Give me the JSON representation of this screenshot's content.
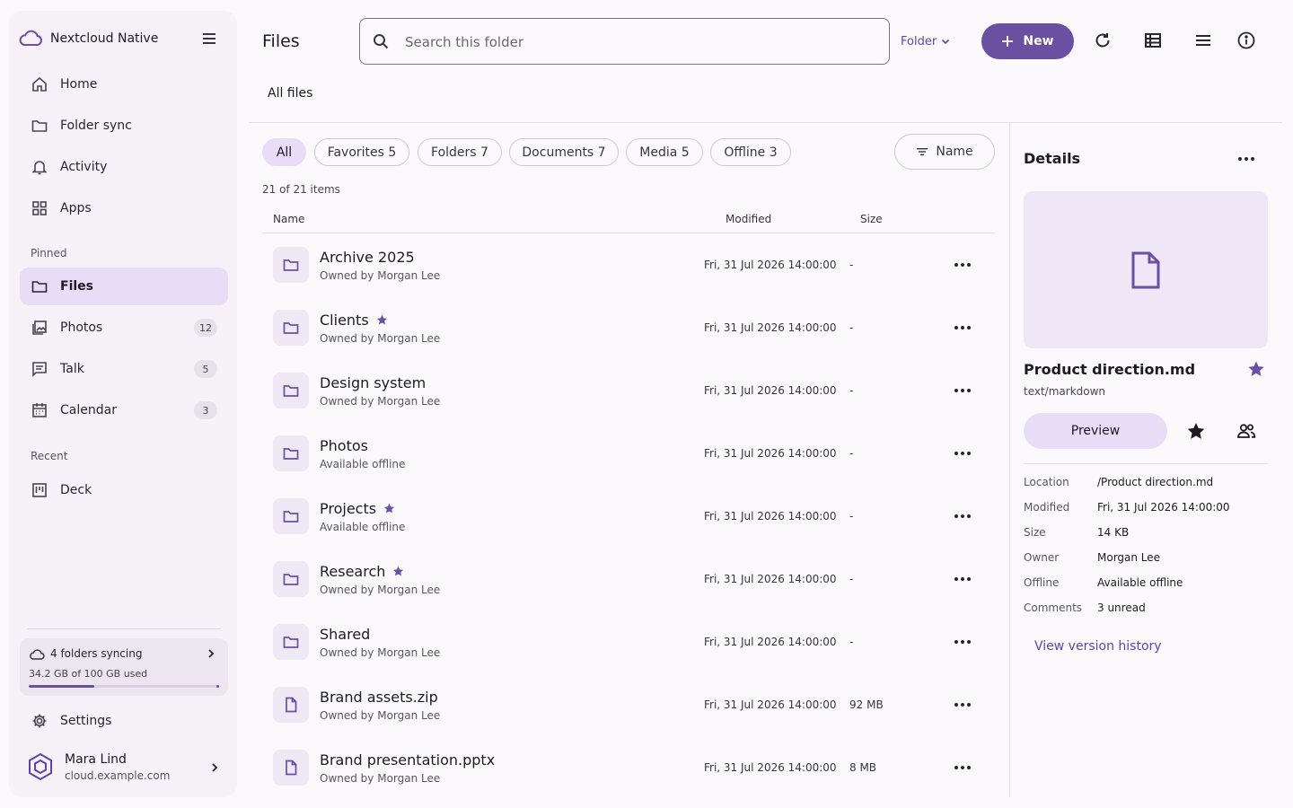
{
  "app": {
    "name": "Nextcloud Native"
  },
  "sidebar": {
    "nav": [
      {
        "label": "Home",
        "icon": "home-icon"
      },
      {
        "label": "Folder sync",
        "icon": "folder-icon"
      },
      {
        "label": "Activity",
        "icon": "bell-icon"
      },
      {
        "label": "Apps",
        "icon": "apps-grid-icon"
      }
    ],
    "pinned_label": "Pinned",
    "pinned": [
      {
        "label": "Files",
        "icon": "folder-icon",
        "active": true
      },
      {
        "label": "Photos",
        "icon": "photos-icon",
        "count": "12"
      },
      {
        "label": "Talk",
        "icon": "chat-icon",
        "count": "5"
      },
      {
        "label": "Calendar",
        "icon": "calendar-icon",
        "count": "3"
      }
    ],
    "recent_label": "Recent",
    "recent": [
      {
        "label": "Deck",
        "icon": "deck-icon"
      }
    ],
    "sync": {
      "status": "4 folders syncing",
      "usage": "34.2 GB of 100 GB used",
      "used_fraction": 0.342
    },
    "settings_label": "Settings",
    "user": {
      "name": "Mara Lind",
      "server": "cloud.example.com"
    }
  },
  "header": {
    "title": "Files",
    "search_placeholder": "Search this folder",
    "scope_label": "Folder",
    "new_label": "New"
  },
  "breadcrumb": "All files",
  "filters": {
    "chips": [
      "All",
      "Favorites 5",
      "Folders 7",
      "Documents 7",
      "Media 5",
      "Offline 3"
    ],
    "active": "All",
    "sort_label": "Name"
  },
  "list": {
    "count_text": "21 of 21 items",
    "columns": {
      "name": "Name",
      "modified": "Modified",
      "size": "Size"
    },
    "rows": [
      {
        "name": "Archive 2025",
        "type": "folder",
        "favorite": false,
        "sub": "Owned by Morgan Lee",
        "modified": "Fri, 31 Jul 2026 14:00:00",
        "size": "-"
      },
      {
        "name": "Clients",
        "type": "folder",
        "favorite": true,
        "sub": "Owned by Morgan Lee",
        "modified": "Fri, 31 Jul 2026 14:00:00",
        "size": "-"
      },
      {
        "name": "Design system",
        "type": "folder",
        "favorite": false,
        "sub": "Owned by Morgan Lee",
        "modified": "Fri, 31 Jul 2026 14:00:00",
        "size": "-"
      },
      {
        "name": "Photos",
        "type": "folder",
        "favorite": false,
        "sub": "Available offline",
        "modified": "Fri, 31 Jul 2026 14:00:00",
        "size": "-"
      },
      {
        "name": "Projects",
        "type": "folder",
        "favorite": true,
        "sub": "Available offline",
        "modified": "Fri, 31 Jul 2026 14:00:00",
        "size": "-"
      },
      {
        "name": "Research",
        "type": "folder",
        "favorite": true,
        "sub": "Owned by Morgan Lee",
        "modified": "Fri, 31 Jul 2026 14:00:00",
        "size": "-"
      },
      {
        "name": "Shared",
        "type": "folder",
        "favorite": false,
        "sub": "Owned by Morgan Lee",
        "modified": "Fri, 31 Jul 2026 14:00:00",
        "size": "-"
      },
      {
        "name": "Brand assets.zip",
        "type": "file",
        "favorite": false,
        "sub": "Owned by Morgan Lee",
        "modified": "Fri, 31 Jul 2026 14:00:00",
        "size": "92 MB"
      },
      {
        "name": "Brand presentation.pptx",
        "type": "file",
        "favorite": false,
        "sub": "Owned by Morgan Lee",
        "modified": "Fri, 31 Jul 2026 14:00:00",
        "size": "8 MB"
      }
    ]
  },
  "details": {
    "title": "Details",
    "file_name": "Product direction.md",
    "mime": "text/markdown",
    "favorite": true,
    "preview_label": "Preview",
    "props": [
      {
        "key": "Location",
        "value": "/Product direction.md"
      },
      {
        "key": "Modified",
        "value": "Fri, 31 Jul 2026 14:00:00"
      },
      {
        "key": "Size",
        "value": "14 KB"
      },
      {
        "key": "Owner",
        "value": "Morgan Lee"
      },
      {
        "key": "Offline",
        "value": "Available offline"
      },
      {
        "key": "Comments",
        "value": "3 unread"
      }
    ],
    "version_link": "View version history"
  },
  "colors": {
    "accent": "#6b4fa0",
    "active_bg": "#e9dcf7",
    "sidebar_bg": "#f6f2f8"
  }
}
